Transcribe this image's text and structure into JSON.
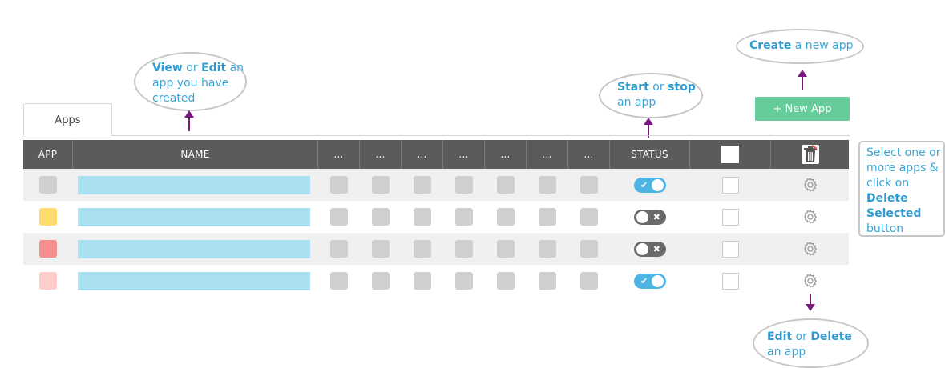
{
  "tabs": [
    {
      "label": "Apps"
    }
  ],
  "new_app_button": "+ New App",
  "table": {
    "headers": [
      "APP",
      "NAME",
      "...",
      "...",
      "...",
      "...",
      "...",
      "...",
      "...",
      "STATUS"
    ],
    "rows": [
      {
        "app_color": "#cfcfcf",
        "status": "on"
      },
      {
        "app_color": "#ffdb70",
        "status": "off"
      },
      {
        "app_color": "#f78e8e",
        "status": "off"
      },
      {
        "app_color": "#ffcccc",
        "status": "on"
      }
    ]
  },
  "annotations": {
    "view_edit": {
      "b1": "View",
      "t1": " or ",
      "b2": "Edit",
      "t2": " an app you have created"
    },
    "start_stop": {
      "b1": "Start",
      "t1": " or ",
      "b2": "stop",
      "t2": " an app"
    },
    "create": {
      "b1": "Create",
      "t1": " a new app"
    },
    "edit_delete": {
      "b1": "Edit",
      "t1": " or ",
      "b2": "Delete",
      "t2": " an app"
    },
    "select_delete": {
      "t1": "Select one or more apps & click on ",
      "b1": "Delete Selected",
      "t2": " button"
    }
  },
  "colors": {
    "header_bg": "#5b5b5b",
    "name_bar": "#abe0f2",
    "toggle_on": "#4fb3e3",
    "toggle_off": "#6a6a6a",
    "new_app_button": "#66cc99",
    "arrow": "#7a1a7e",
    "note_text": "#3aa6d6"
  }
}
